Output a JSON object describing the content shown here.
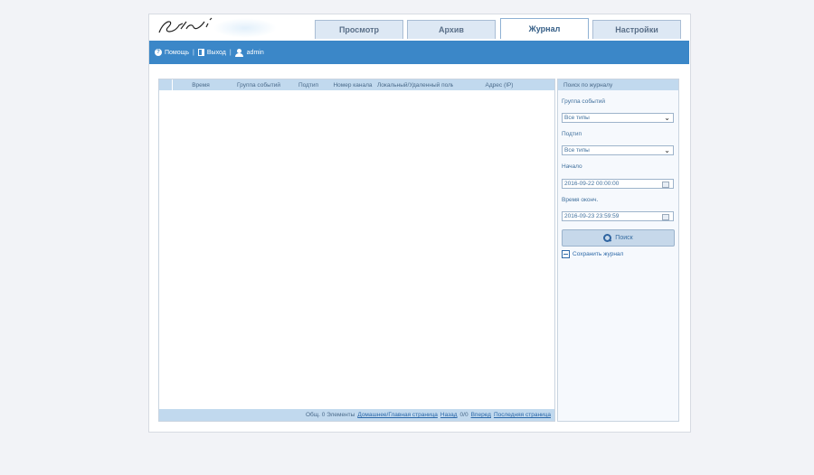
{
  "brand": {
    "logo_text": "Stile"
  },
  "tabs": [
    {
      "label": "Просмотр",
      "active": false
    },
    {
      "label": "Архив",
      "active": false
    },
    {
      "label": "Журнал",
      "active": true
    },
    {
      "label": "Настройки",
      "active": false
    }
  ],
  "topbar": {
    "help": "Помощь",
    "exit": "Выход",
    "user": "admin",
    "sep": "|"
  },
  "table": {
    "columns": [
      "Время",
      "Группа событий",
      "Подтип",
      "Номер канала",
      "Локальный/Удаленный польз.",
      "Адрес (IP)"
    ],
    "rows": []
  },
  "pager": {
    "total": "Общ. 0 Элементы",
    "home": "Домашнее/Главная страница",
    "prev": "Назад",
    "pages": "0/0",
    "next": "Вперед",
    "last": "Последняя страница"
  },
  "search_panel": {
    "title": "Поиск по журналу",
    "group_label": "Группа событий",
    "group_value": "Все типы",
    "subtype_label": "Подтип",
    "subtype_value": "Все типы",
    "start_label": "Начало",
    "start_value": "2016-09-22 00:00:00",
    "end_label": "Время оконч.",
    "end_value": "2016-09-23 23:59:59",
    "search_button": "Поиск",
    "save_log": "Сохранить журнал"
  },
  "colors": {
    "accent": "#3b87c8",
    "header_bg": "#c1d9ee",
    "tab_bg": "#dde8f4"
  }
}
